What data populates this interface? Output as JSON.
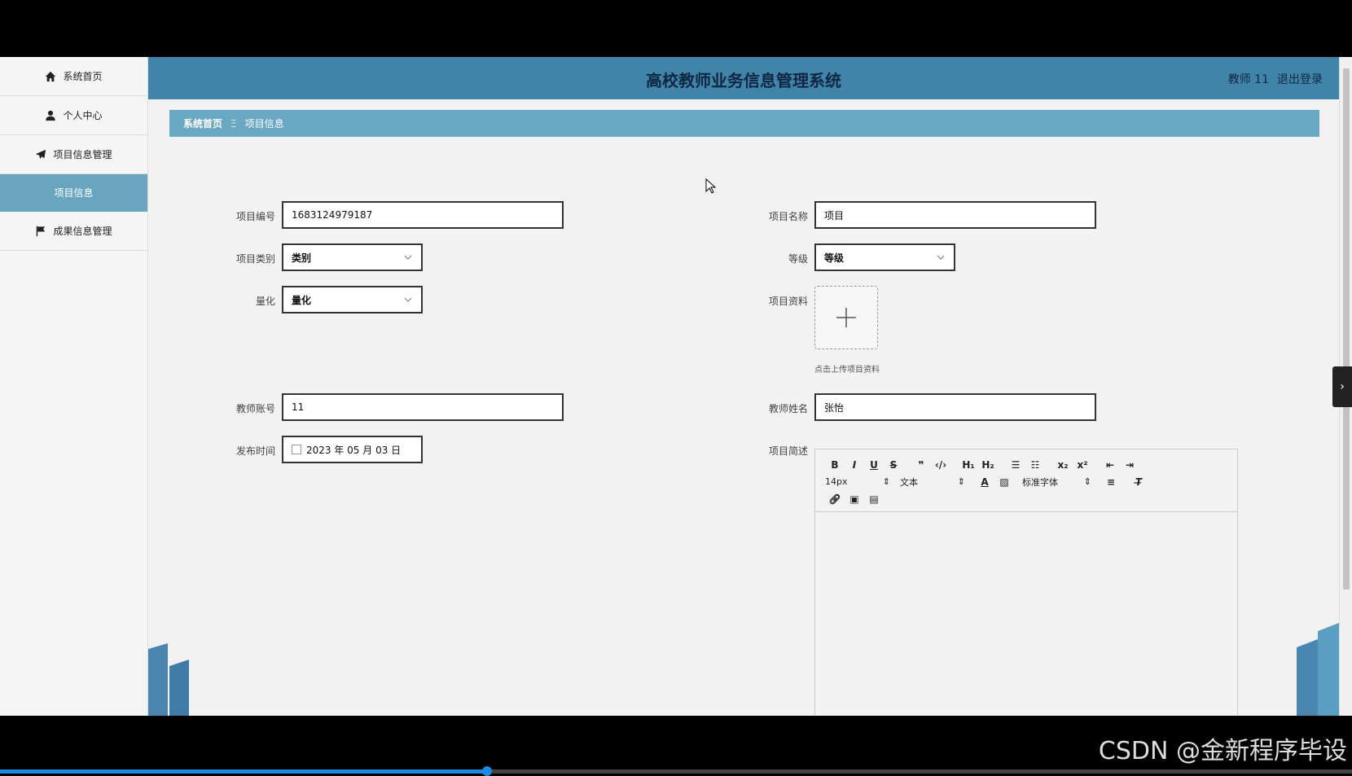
{
  "header": {
    "title": "高校教师业务信息管理系统",
    "user": "教师 11",
    "logout": "退出登录"
  },
  "sidebar": {
    "items": [
      {
        "label": "系统首页",
        "icon": "home-icon"
      },
      {
        "label": "个人中心",
        "icon": "user-icon"
      },
      {
        "label": "项目信息管理",
        "icon": "paper-plane-icon"
      },
      {
        "label": "项目信息",
        "icon": ""
      },
      {
        "label": "成果信息管理",
        "icon": "flag-icon"
      }
    ]
  },
  "breadcrumb": {
    "home": "系统首页",
    "separator": "Ξ",
    "current": "项目信息"
  },
  "form": {
    "project_no_label": "项目编号",
    "project_no": "1683124979187",
    "project_name_label": "项目名称",
    "project_name": "项目",
    "category_label": "项目类别",
    "category": "类别",
    "level_label": "等级",
    "level": "等级",
    "quant_label": "量化",
    "quant": "量化",
    "material_label": "项目资料",
    "upload_hint": "点击上传项目资料",
    "teacher_account_label": "教师账号",
    "teacher_account": "11",
    "teacher_name_label": "教师姓名",
    "teacher_name": "张怡",
    "publish_time_label": "发布时间",
    "publish_time": "2023 年 05 月 03 日",
    "intro_label": "项目简述"
  },
  "editor": {
    "font_size": "14px",
    "paragraph": "文本",
    "font_family": "标准字体"
  },
  "watermark": "CSDN @金新程序毕设",
  "video": {
    "progress": 0.36
  },
  "colors": {
    "header": "#4184aa",
    "breadcrumb": "#6aa7c2",
    "active_sidebar": "#6aa5c0"
  }
}
